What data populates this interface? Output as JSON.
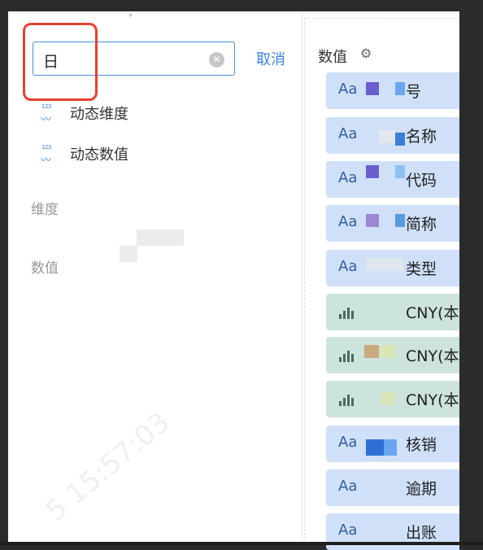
{
  "search": {
    "value": "日",
    "clear_icon": "close-circle-icon",
    "cancel_label": "取消"
  },
  "field_list": [
    {
      "icon": "dynamic-field-icon",
      "icon_text": "123",
      "label": "动态维度"
    },
    {
      "icon": "dynamic-field-icon",
      "icon_text": "123",
      "label": "动态数值"
    }
  ],
  "sections": {
    "dimension_title": "维度",
    "value_title": "数值"
  },
  "right_panel": {
    "title": "数值",
    "settings_icon": "gear-icon",
    "items": [
      {
        "kind": "dimension",
        "type_label": "Aa",
        "name": "号"
      },
      {
        "kind": "dimension",
        "type_label": "Aa",
        "name": "名称"
      },
      {
        "kind": "dimension",
        "type_label": "Aa",
        "name": "代码"
      },
      {
        "kind": "dimension",
        "type_label": "Aa",
        "name": "简称"
      },
      {
        "kind": "dimension",
        "type_label": "Aa",
        "name": "类型"
      },
      {
        "kind": "measure",
        "type_label": "bar-chart-icon",
        "name": "CNY(本"
      },
      {
        "kind": "measure",
        "type_label": "bar-chart-icon",
        "name": "CNY(本"
      },
      {
        "kind": "measure",
        "type_label": "bar-chart-icon",
        "name": "CNY(本"
      },
      {
        "kind": "dimension",
        "type_label": "Aa",
        "name": "核销"
      },
      {
        "kind": "dimension",
        "type_label": "Aa",
        "name": "逾期"
      },
      {
        "kind": "dimension",
        "type_label": "Aa",
        "name": "出账"
      }
    ]
  },
  "watermark": "5 15:57:03",
  "colors": {
    "accent": "#3b82d6",
    "highlight": "#e8402f",
    "dimension_pill": "#cfe0f8",
    "measure_pill": "#cde3dd"
  }
}
